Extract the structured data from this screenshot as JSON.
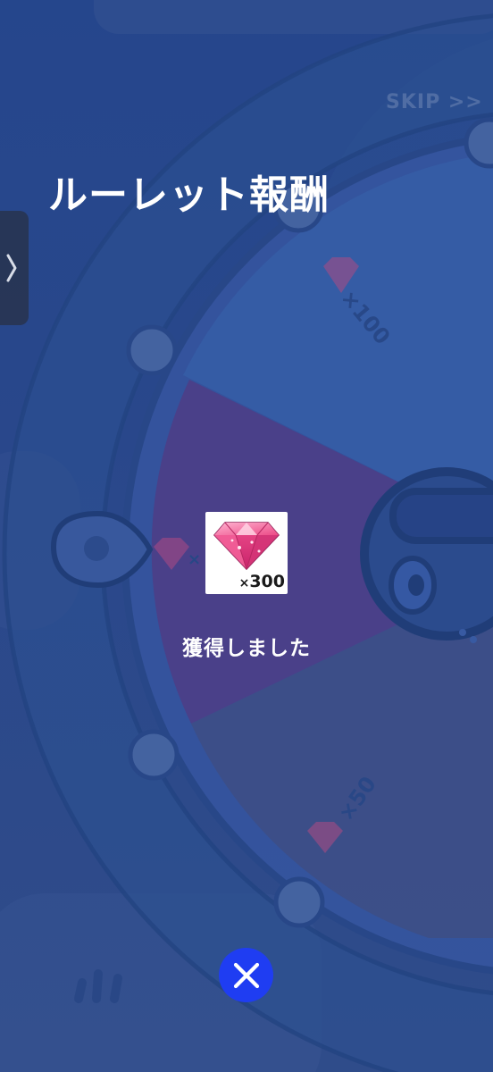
{
  "header": {
    "skip_label": "SKIP >>",
    "title": "ルーレット報酬"
  },
  "wheel": {
    "segments": [
      {
        "reward_icon": "gem-icon",
        "label": "×100"
      },
      {
        "reward_icon": "gem-icon",
        "label": "×300"
      },
      {
        "reward_icon": "gem-icon",
        "label": "×50"
      }
    ]
  },
  "reward": {
    "icon": "gem-icon",
    "count_prefix": "×",
    "count": "300",
    "message": "獲得しました"
  },
  "controls": {
    "side_tab_icon": "chevron-right-icon",
    "close_icon": "close-icon"
  },
  "colors": {
    "background": "#2b4a8e",
    "highlight_segment": "#51428e",
    "close_button": "#1f3df2",
    "gem": "#ec4a86"
  }
}
